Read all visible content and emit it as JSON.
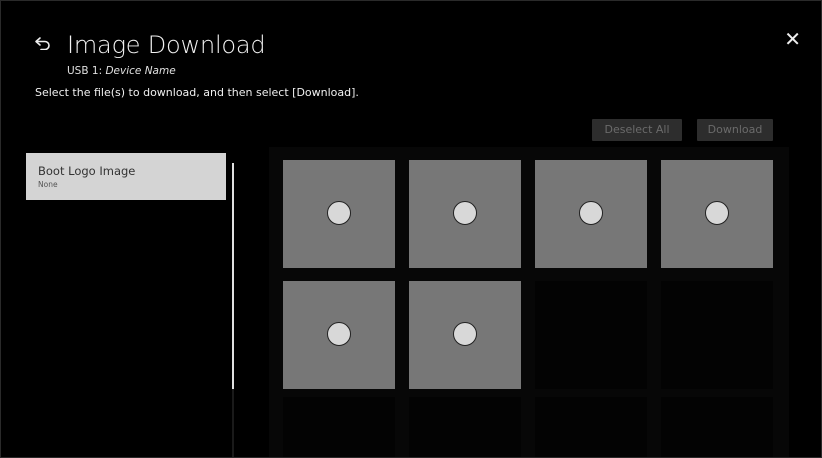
{
  "header": {
    "title": "Image Download",
    "source_prefix": "USB 1: ",
    "device_name": "Device Name",
    "instruction": "Select the file(s) to download, and then select [Download]."
  },
  "buttons": {
    "deselect_all": "Deselect All",
    "download": "Download"
  },
  "sidebar": {
    "items": [
      {
        "label": "Boot Logo Image",
        "value": "None"
      }
    ]
  },
  "grid": {
    "images": [
      {
        "selected": false
      },
      {
        "selected": false
      },
      {
        "selected": false
      },
      {
        "selected": false
      },
      {
        "selected": false
      },
      {
        "selected": false
      }
    ]
  },
  "colors": {
    "tile": "#777777",
    "button_disabled_bg": "#2d2d2d",
    "button_disabled_text": "#6b6b6b",
    "sidebar_item_bg": "#d4d4d4"
  }
}
